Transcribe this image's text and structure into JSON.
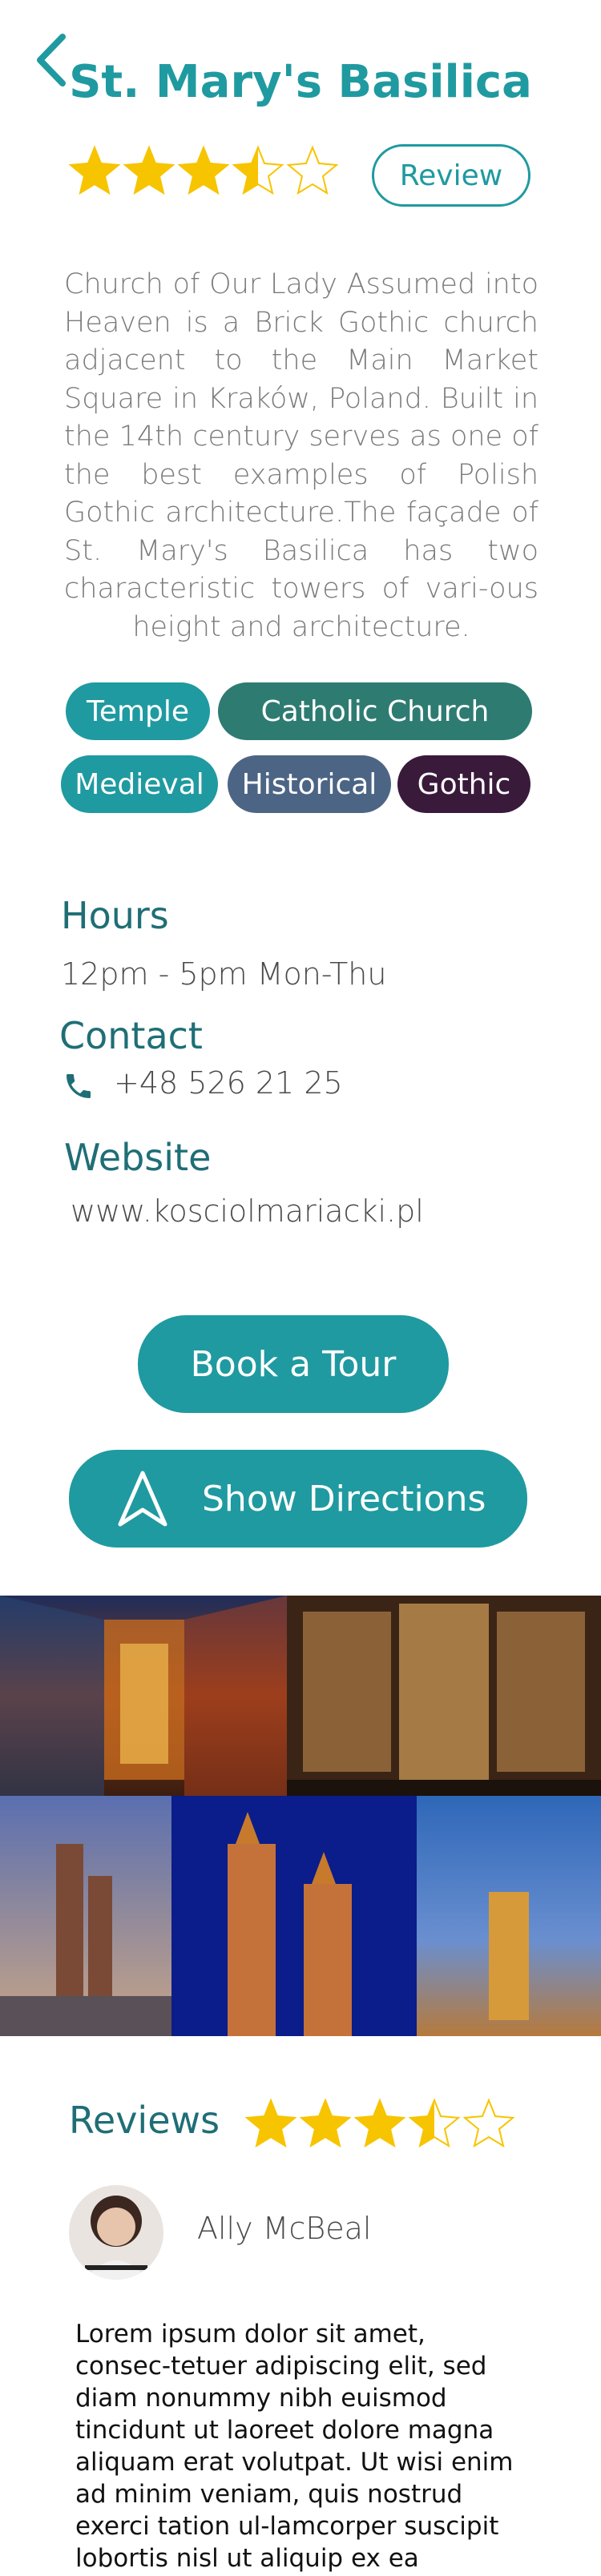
{
  "header": {
    "title": "St. Mary's Basilica",
    "back_icon": "chevron-left-icon"
  },
  "rating": {
    "value": 3.5,
    "max": 5,
    "review_label": "Review"
  },
  "description": "Church of Our Lady Assumed into Heaven is a Brick Gothic church adjacent to the Main Market Square in Kraków, Poland. Built in the 14th century serves as one of the best examples of Polish Gothic architecture.The façade of St. Mary's Basilica has two characteristic towers of vari-ous height and architecture.",
  "tags": [
    {
      "label": "Temple",
      "color": "#1f9aa0"
    },
    {
      "label": "Catholic Church",
      "color": "#2e7b71"
    },
    {
      "label": "Medieval",
      "color": "#1f9aa0"
    },
    {
      "label": "Historical",
      "color": "#4c6585"
    },
    {
      "label": "Gothic",
      "color": "#3a1a3a"
    }
  ],
  "hours": {
    "heading": "Hours",
    "value": "12pm - 5pm Mon-Thu"
  },
  "contact": {
    "heading": "Contact",
    "phone": "+48 526 21 25",
    "icon": "phone-icon"
  },
  "website": {
    "heading": "Website",
    "url": "www.kosciolmariacki.pl"
  },
  "actions": {
    "book": "Book a Tour",
    "directions": "Show Directions",
    "directions_icon": "navigation-arrow-icon"
  },
  "colors": {
    "primary": "#1f9aa0",
    "heading": "#1f6e76",
    "star": "#f7c400"
  },
  "reviews": {
    "heading": "Reviews",
    "rating": 3.5,
    "items": [
      {
        "author": "Ally McBeal",
        "text": "Lorem ipsum dolor sit amet, consec-tetuer adipiscing elit, sed diam nonummy nibh euismod tincidunt ut laoreet dolore magna aliquam erat volutpat. Ut wisi enim ad minim veniam, quis nostrud exerci tation ul-lamcorper suscipit lobortis nisl ut aliquip ex ea commodo consequat."
      }
    ]
  }
}
